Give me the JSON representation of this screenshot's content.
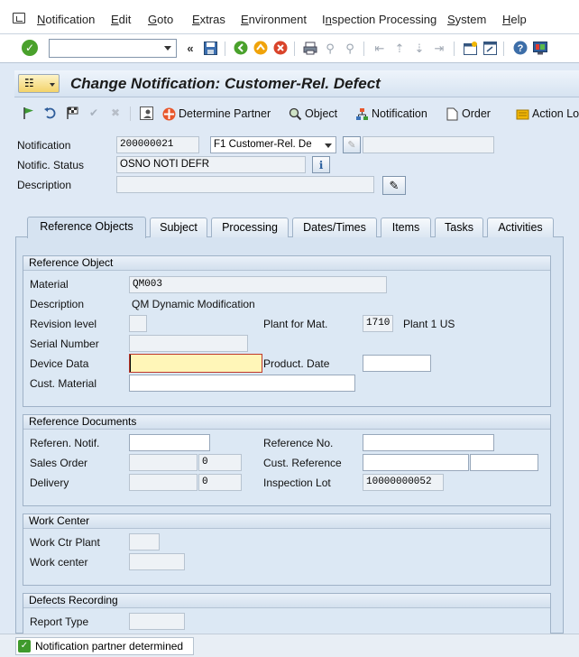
{
  "menubar": {
    "items": [
      {
        "label": "Notification",
        "mnemonic": "N",
        "rest": "otification"
      },
      {
        "label": "Edit",
        "mnemonic": "E",
        "rest": "dit"
      },
      {
        "label": "Goto",
        "mnemonic": "G",
        "rest": "oto"
      },
      {
        "label": "Extras",
        "mnemonic": "E",
        "rest": "xtras"
      },
      {
        "label": "Environment",
        "mnemonic": "E",
        "rest": "nvironment"
      },
      {
        "label": "Inspection Processing",
        "pre": "I",
        "mnemonic": "n",
        "rest": "spection Processing"
      },
      {
        "label": "System",
        "mnemonic": "S",
        "rest": "ystem"
      },
      {
        "label": "Help",
        "mnemonic": "H",
        "rest": "elp"
      }
    ]
  },
  "toolbar": {
    "command_field_value": "",
    "icons": [
      "enter-icon",
      "save-icon",
      "back-icon",
      "exit-icon",
      "cancel-icon",
      "print-icon",
      "find-icon",
      "find-next-icon",
      "first-page-icon",
      "prev-page-icon",
      "next-page-icon",
      "last-page-icon",
      "create-session-icon",
      "shortcut-icon",
      "help-icon",
      "customize-layout-icon"
    ]
  },
  "title": "Change Notification: Customer-Rel. Defect",
  "app_toolbar": {
    "determine_partner": "Determine Partner",
    "object": "Object",
    "notification": "Notification",
    "order": "Order",
    "action_log": "Action Lo"
  },
  "header": {
    "notification_label": "Notification",
    "notification_value": "200000021",
    "notification_type": "F1 Customer-Rel. De",
    "notification_extra": "",
    "status_label": "Notific. Status",
    "status_value": "OSNO NOTI DEFR",
    "description_label": "Description",
    "description_value": ""
  },
  "tabs": [
    "Reference Objects",
    "Subject",
    "Processing",
    "Dates/Times",
    "Items",
    "Tasks",
    "Activities"
  ],
  "active_tab": "Reference Objects",
  "reference_object": {
    "title": "Reference Object",
    "material_label": "Material",
    "material_value": "QM003",
    "description_label": "Description",
    "description_value": "QM Dynamic Modification",
    "revision_label": "Revision level",
    "revision_value": "",
    "plant_label": "Plant for Mat.",
    "plant_value": "1710",
    "plant_text": "Plant 1 US",
    "serial_label": "Serial Number",
    "serial_value": "",
    "device_label": "Device Data",
    "device_value": "",
    "product_date_label": "Product. Date",
    "product_date_value": "",
    "cust_material_label": "Cust. Material",
    "cust_material_value": ""
  },
  "reference_documents": {
    "title": "Reference Documents",
    "ref_notif_label": "Referen. Notif.",
    "ref_notif_value": "",
    "ref_no_label": "Reference No.",
    "ref_no_value": "",
    "sales_order_label": "Sales Order",
    "sales_order_value": "",
    "sales_order_item": "0",
    "cust_ref_label": "Cust. Reference",
    "cust_ref_value": "",
    "cust_ref_date": "",
    "delivery_label": "Delivery",
    "delivery_value": "",
    "delivery_item": "0",
    "insp_lot_label": "Inspection Lot",
    "insp_lot_value": "10000000052"
  },
  "work_center": {
    "title": "Work Center",
    "plant_label": "Work Ctr Plant",
    "plant_value": "",
    "wc_label": "Work center",
    "wc_value": ""
  },
  "defects": {
    "title": "Defects Recording",
    "report_type_label": "Report Type",
    "report_type_value": ""
  },
  "status_message": "Notification partner determined",
  "colors": {
    "accent": "#d6e3f1",
    "ok_green": "#4aa12c",
    "highlight_field": "#fff6b8"
  }
}
